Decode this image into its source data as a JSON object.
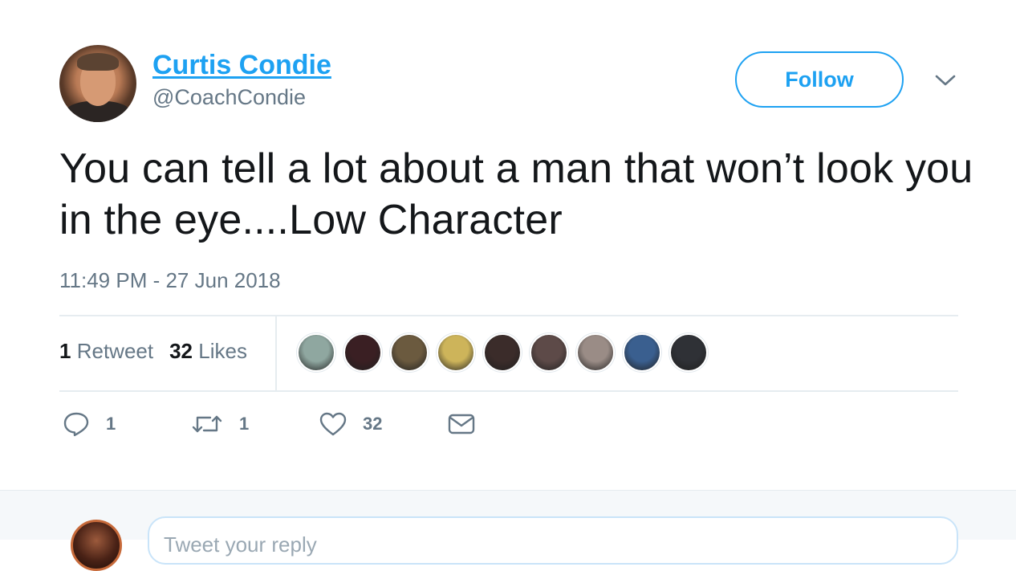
{
  "user": {
    "name": "Curtis Condie",
    "handle": "@CoachCondie"
  },
  "follow_label": "Follow",
  "tweet": {
    "text": "You can tell a lot about a man that won’t look you in the eye....Low Character",
    "timestamp": "11:49 PM - 27 Jun 2018"
  },
  "stats": {
    "retweet_count": "1",
    "retweet_label": "Retweet",
    "like_count": "32",
    "like_label": "Likes"
  },
  "likers": [
    {
      "color": "#8fa7a0"
    },
    {
      "color": "#3a1f23"
    },
    {
      "color": "#6b5a3f"
    },
    {
      "color": "#cdb45a"
    },
    {
      "color": "#3b2c2a"
    },
    {
      "color": "#5d4a48"
    },
    {
      "color": "#9a8c86"
    },
    {
      "color": "#3a5f8f"
    },
    {
      "color": "#2f3136"
    }
  ],
  "actions": {
    "reply_count": "1",
    "retweet_count": "1",
    "like_count": "32"
  },
  "reply_placeholder": "Tweet your reply",
  "colors": {
    "accent": "#1da1f2",
    "secondary_text": "#657786",
    "divider": "#e6ecf0"
  }
}
